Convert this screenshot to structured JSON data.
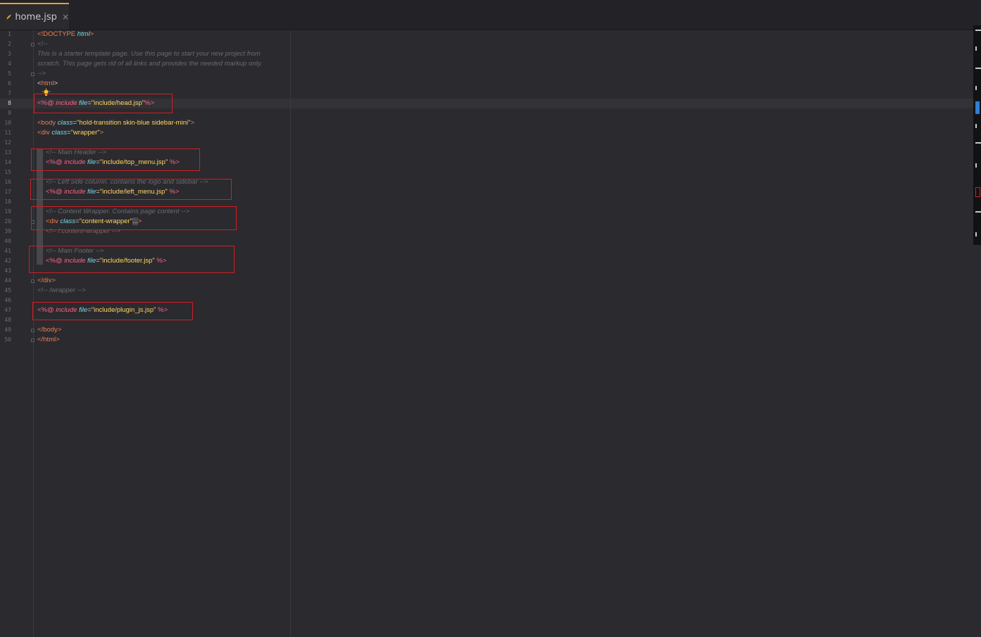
{
  "tab": {
    "label": "home.jsp",
    "close": "×"
  },
  "line_numbers": [
    "1",
    "2",
    "3",
    "4",
    "5",
    "6",
    "7",
    "8",
    "9",
    "10",
    "11",
    "12",
    "13",
    "14",
    "15",
    "16",
    "17",
    "18",
    "19",
    "20",
    "39",
    "40",
    "41",
    "42",
    "43",
    "44",
    "45",
    "46",
    "47",
    "48",
    "49",
    "50"
  ],
  "current_line": "8",
  "code": {
    "l1": {
      "open": "<!DOCTYPE ",
      "kw": "html",
      "close": ">"
    },
    "l2": "<!--",
    "l3": "This is a starter template page. Use this page to start your new project from",
    "l4": "scratch. This page gets rid of all links and provides the needed markup only.",
    "l5": "-->",
    "l6": {
      "lt": "<",
      "name": "html",
      "gt": ">"
    },
    "l8": {
      "open": "<%@ ",
      "kw": "include",
      "attr": " file",
      "eq": "=",
      "val": "\"include/head.jsp\"",
      "close": "%>"
    },
    "l10": {
      "open": "<body ",
      "attr": "class",
      "eq": "=",
      "val": "\"hold-transition skin-blue sidebar-mini\"",
      "close": ">"
    },
    "l11": {
      "open": "<div ",
      "attr": "class",
      "eq": "=",
      "val": "\"wrapper\"",
      "close": ">"
    },
    "l13": "<!-- Main Header -->",
    "l14": {
      "open": "<%@ ",
      "kw": "include",
      "attr": " file",
      "eq": "=",
      "val": "\"include/top_menu.jsp\"",
      "close": " %>"
    },
    "l16": "<!-- Left side column. contains the logo and sidebar -->",
    "l17": {
      "open": "<%@ ",
      "kw": "include",
      "attr": " file",
      "eq": "=",
      "val": "\"include/left_menu.jsp\"",
      "close": " %>"
    },
    "l19": "<!-- Content Wrapper. Contains page content -->",
    "l20": {
      "open": "<div ",
      "attr": "class",
      "eq": "=",
      "val": "\"content-wrapper\"",
      "ell": "...",
      "close": ">"
    },
    "l39": "<!-- /.content-wrapper -->",
    "l41": "<!-- Main Footer -->",
    "l42": {
      "open": "<%@ ",
      "kw": "include",
      "attr": " file",
      "eq": "=",
      "val": "\"include/footer.jsp\"",
      "close": " %>"
    },
    "l44": "</div>",
    "l45": "<!-- /wrapper -->",
    "l47": {
      "open": "<%@ ",
      "kw": "include",
      "attr": " file",
      "eq": "=",
      "val": "\"include/plugin_js.jsp\"",
      "close": " %>"
    },
    "l49": "</body>",
    "l50": "</html>"
  }
}
